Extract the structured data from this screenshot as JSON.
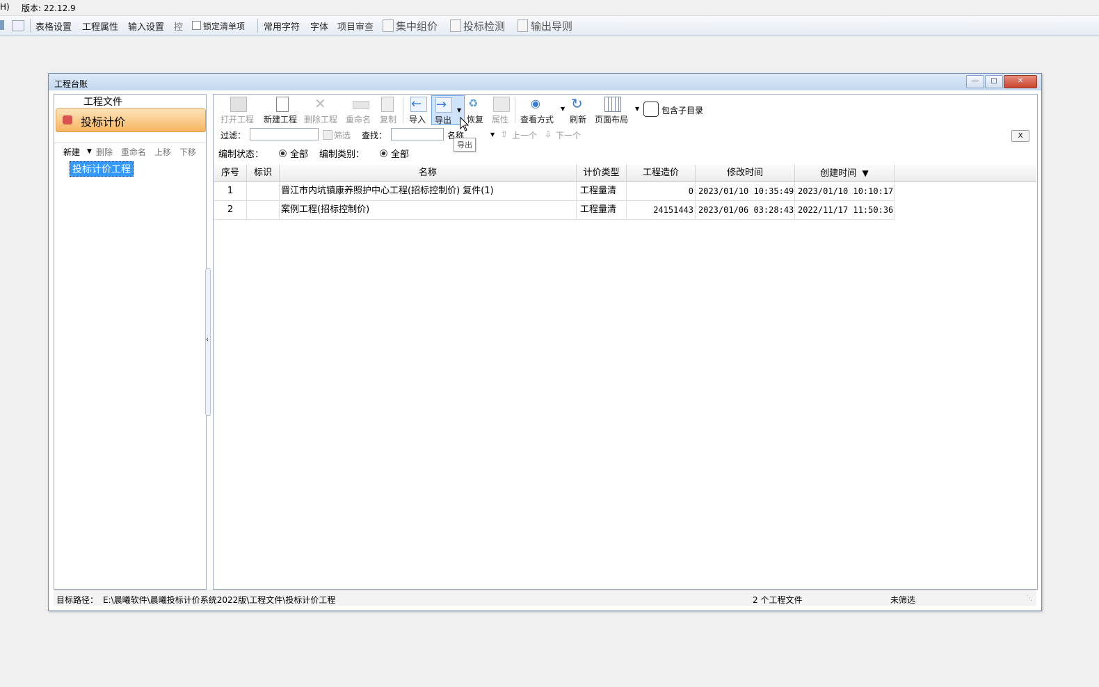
{
  "topbar": {
    "menu_fragment": "H)",
    "version": "版本: 22.12.9"
  },
  "toolbar": {
    "table_settings": "表格设置",
    "project_props": "工程属性",
    "input_settings": "输入设置",
    "control": "控",
    "lock_list": "锁定清单项",
    "common_chars": "常用字符",
    "font": "字体",
    "project_review": "项目审查",
    "central_pricing": "集中组价",
    "bid_check": "投标检测",
    "export_guide": "输出导则"
  },
  "dialog": {
    "title": "工程台账",
    "nav_header": "工程文件",
    "nav_active": "投标计价",
    "left_tools": {
      "new": "新建",
      "delete": "删除",
      "rename": "重命名",
      "up": "上移",
      "down": "下移"
    },
    "tree_node": "投标计价工程",
    "tools": {
      "open": "打开工程",
      "new_project": "新建工程",
      "delete_project": "删除工程",
      "rename": "重命名",
      "copy": "复制",
      "import": "导入",
      "export": "导出",
      "restore": "恢复",
      "properties": "属性",
      "view_mode": "查看方式",
      "refresh": "刷新",
      "page_layout": "页面布局",
      "include_sub": "包含子目录"
    },
    "tooltip": "导出",
    "filter": {
      "filter_label": "过滤：",
      "filter_value": "",
      "filter_btn": "筛选",
      "find_label": "查找：",
      "find_value": "",
      "find_field": "名称",
      "prev": "上一个",
      "next": "下一个",
      "close": "X"
    },
    "status_filter": {
      "status_label": "编制状态：",
      "status_opt": "全部",
      "type_label": "编制类别：",
      "type_opt": "全部"
    },
    "columns": [
      "序号",
      "标识",
      "名称",
      "计价类型",
      "工程造价",
      "修改时间",
      "创建时间"
    ],
    "rows": [
      {
        "no": "1",
        "flag": "",
        "name": "晋江市内坑镇康养照护中心工程(招标控制价) 复件(1)",
        "type": "工程量清",
        "cost": "0",
        "modified": "2023/01/10 10:35:49",
        "created": "2023/01/10 10:10:17"
      },
      {
        "no": "2",
        "flag": "",
        "name": "案例工程(招标控制价)",
        "type": "工程量清",
        "cost": "24151443",
        "modified": "2023/01/06 03:28:43",
        "created": "2022/11/17 11:50:36"
      }
    ],
    "status": {
      "path_label": "目标路径：",
      "path": "E:\\晨曦软件\\晨曦投标计价系统2022版\\工程文件\\投标计价工程",
      "count": "2 个工程文件",
      "filter_state": "未筛选"
    }
  },
  "colors": {
    "accent": "#3399ff",
    "nav_active": "#f7b560",
    "selection": "#3399ff"
  }
}
